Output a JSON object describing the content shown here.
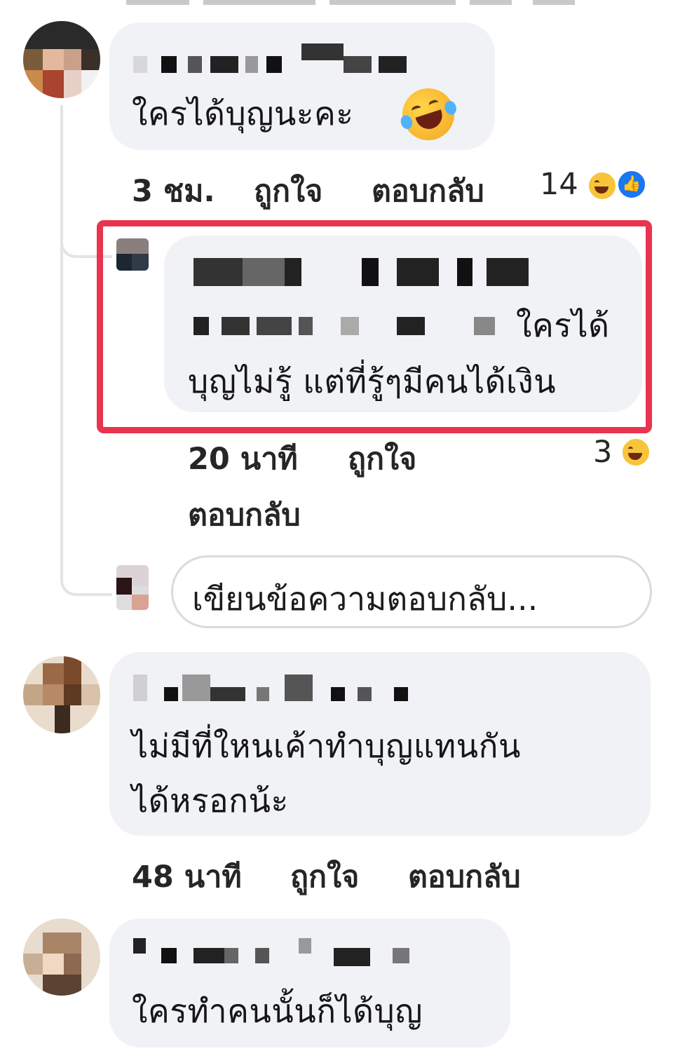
{
  "comments": [
    {
      "text_lines": [
        "ใครได้บุญนะคะ"
      ],
      "emoji": "rolling-on-floor-laughing-emoji",
      "meta": {
        "time": "3 ชม.",
        "like": "ถูกใจ",
        "reply": "ตอบกลับ"
      },
      "reactions": {
        "count": "14",
        "types": [
          "haha-icon",
          "like-icon"
        ]
      }
    },
    {
      "text_lines": [
        "ใครได้",
        "บุญไม่รู้ แต่ที่รู้ๆมีคนได้เงิน"
      ],
      "highlighted": true,
      "meta": {
        "time": "20 นาที",
        "like": "ถูกใจ",
        "reply": "ตอบกลับ"
      },
      "reactions": {
        "count": "3",
        "types": [
          "haha-icon"
        ]
      }
    },
    {
      "text_lines": [
        "ไม่มีที่ใหนเค้าทำบุญแทนกัน",
        "ได้หรอกน้ะ"
      ],
      "meta": {
        "time": "48 นาที",
        "like": "ถูกใจ",
        "reply": "ตอบกลับ"
      }
    },
    {
      "text_lines": [
        "ใครทำคนนั้นก็ได้บุญ"
      ]
    }
  ],
  "reply_box": {
    "placeholder": "เขียนข้อความตอบกลับ..."
  },
  "colors": {
    "bubble": "#f0f2f5",
    "highlight": "#e8344e",
    "like_blue": "#1877f2",
    "haha_yellow": "#f7c43a"
  }
}
